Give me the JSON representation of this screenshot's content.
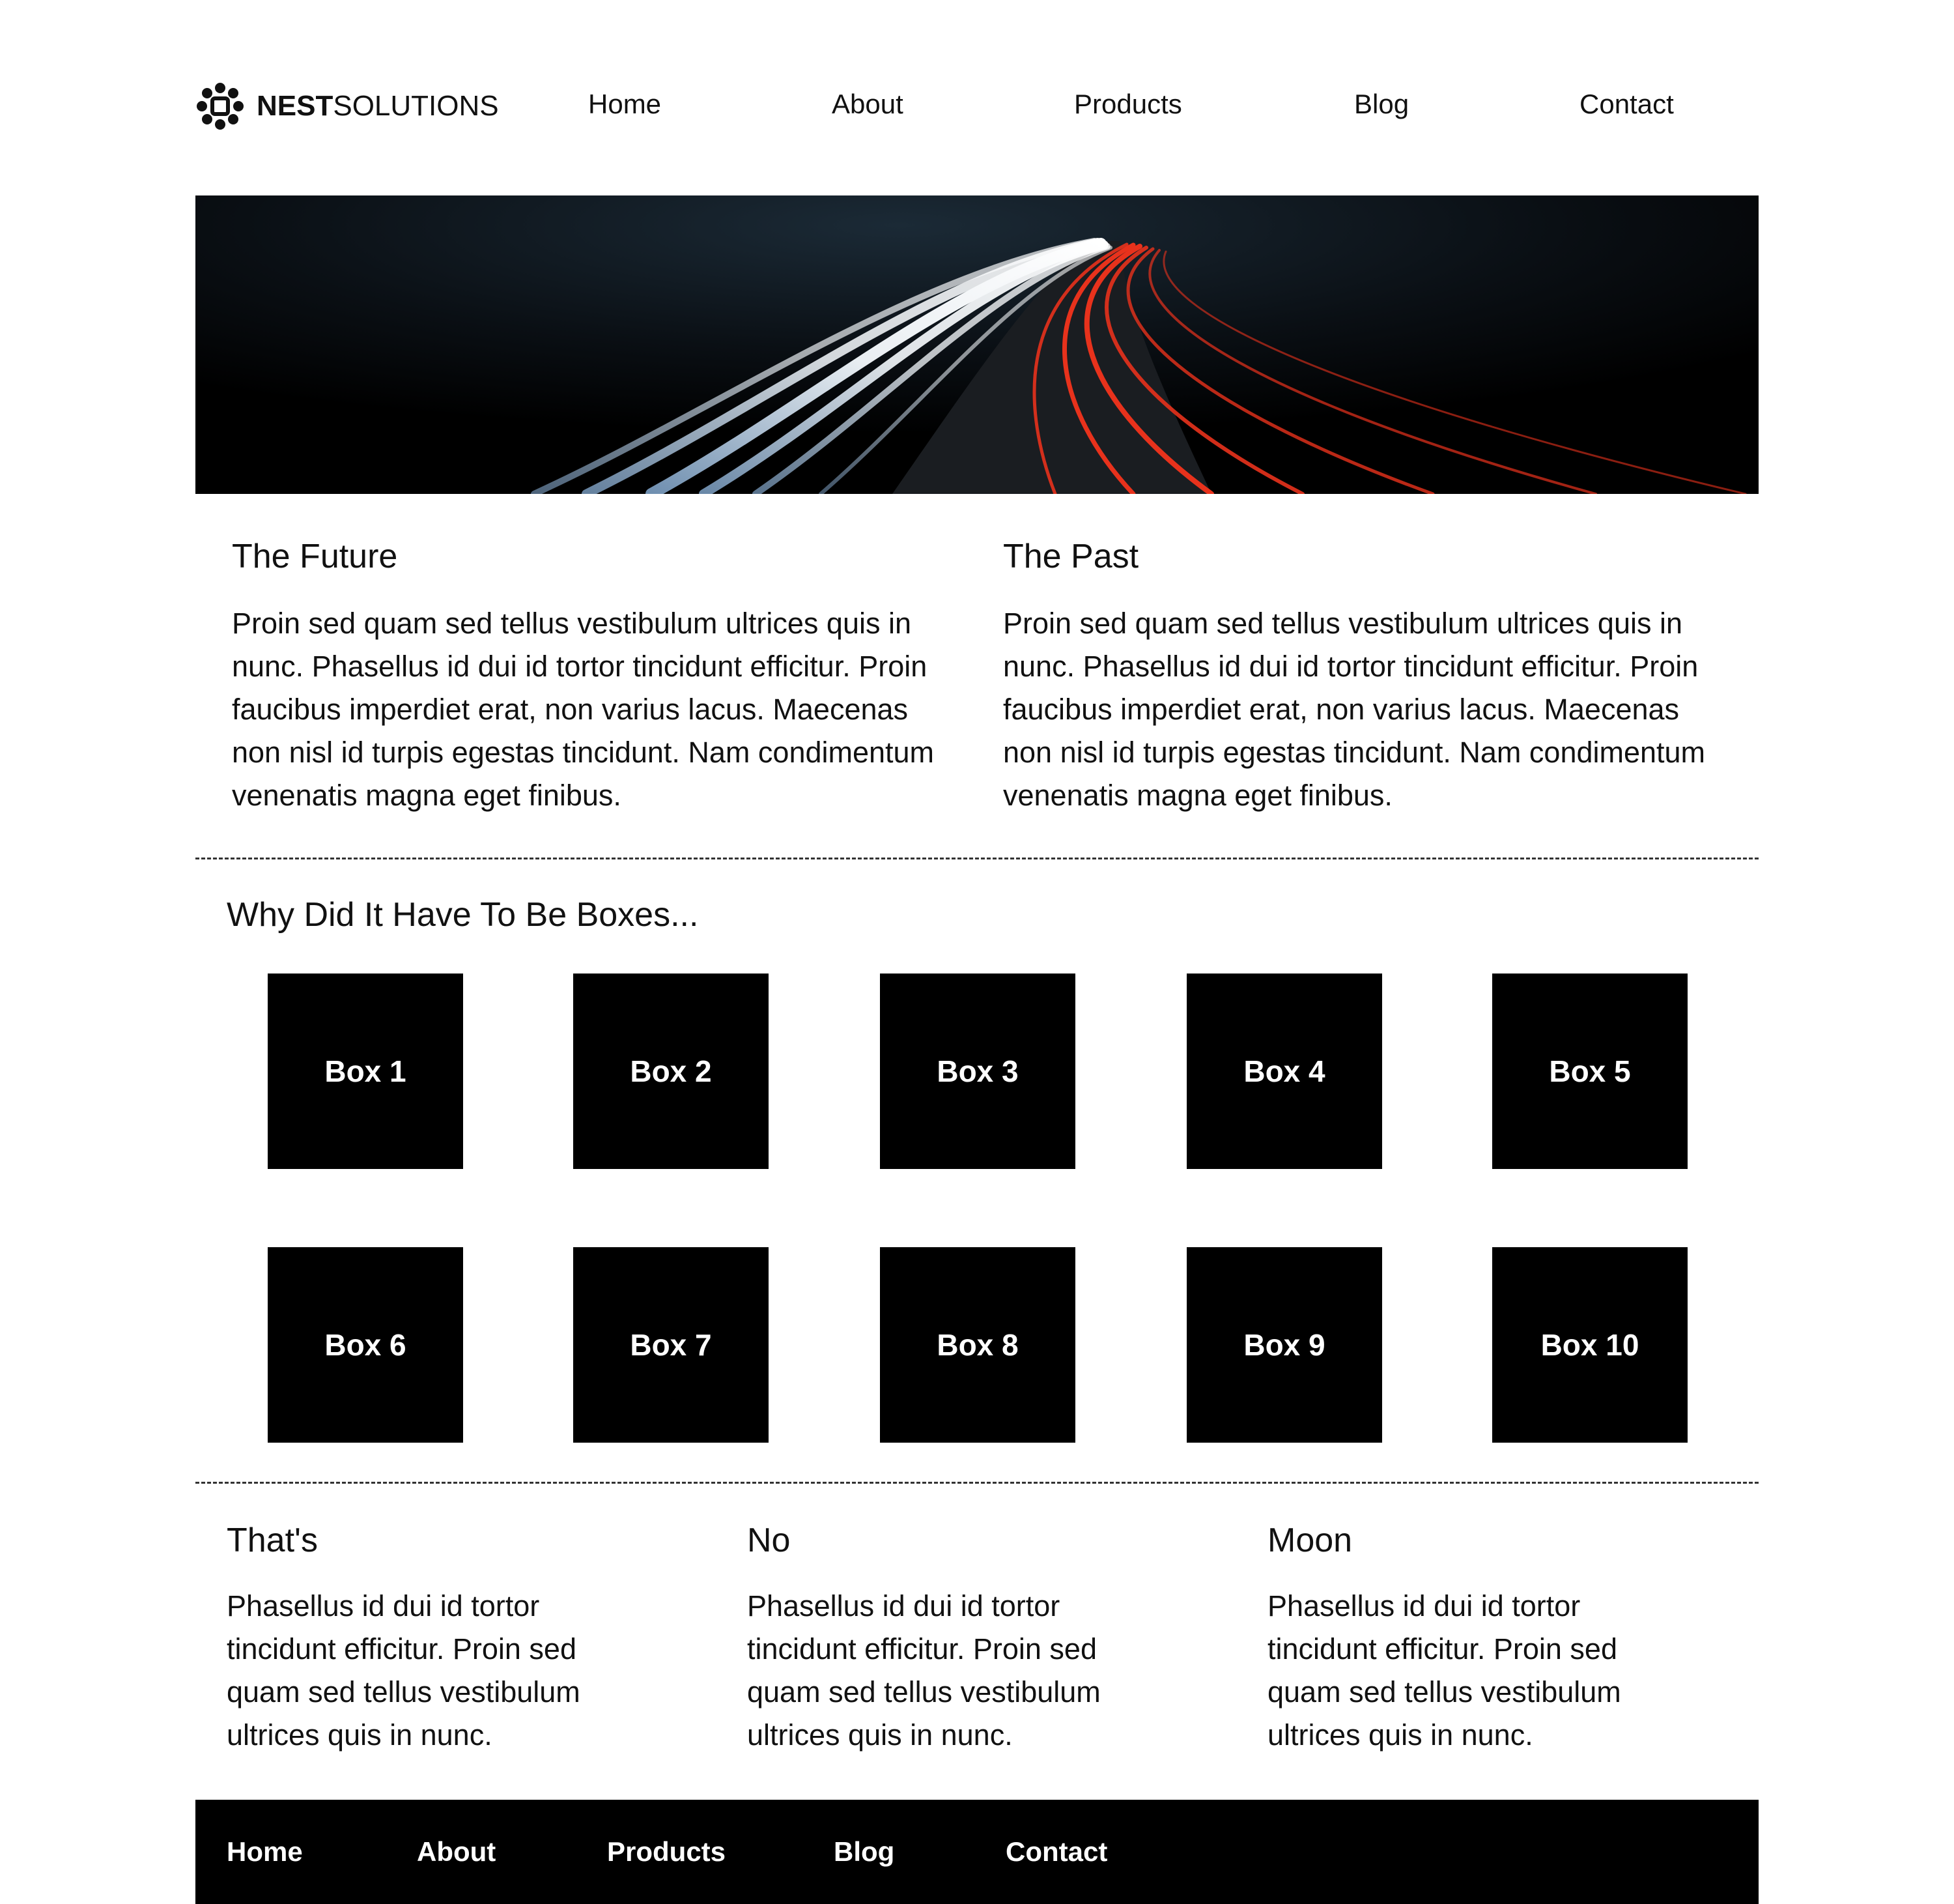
{
  "brand": {
    "bold": "NEST",
    "regular": "SOLUTIONS"
  },
  "nav": [
    "Home",
    "About",
    "Products",
    "Blog",
    "Contact"
  ],
  "intro": [
    {
      "title": "The Future",
      "text": "Proin sed quam sed tellus vestibulum ultrices quis in nunc. Phasellus id dui id tortor tincidunt efficitur. Proin faucibus imperdiet erat, non varius lacus. Maecenas non nisl id turpis egestas tincidunt. Nam condimentum venenatis magna eget finibus."
    },
    {
      "title": "The Past",
      "text": "Proin sed quam sed tellus vestibulum ultrices quis in nunc. Phasellus id dui id tortor tincidunt efficitur. Proin faucibus imperdiet erat, non varius lacus. Maecenas non nisl id turpis egestas tincidunt. Nam condimentum venenatis magna eget finibus."
    }
  ],
  "boxes_title": "Why Did It Have To Be Boxes...",
  "boxes": [
    "Box 1",
    "Box 2",
    "Box 3",
    "Box 4",
    "Box 5",
    "Box 6",
    "Box 7",
    "Box 8",
    "Box 9",
    "Box 10"
  ],
  "features": [
    {
      "title": "That's",
      "text": "Phasellus id dui id tortor tincidunt efficitur. Proin sed quam sed tellus vestibulum ultrices quis in nunc."
    },
    {
      "title": "No",
      "text": "Phasellus id dui id tortor tincidunt efficitur. Proin sed quam sed tellus vestibulum ultrices quis in nunc."
    },
    {
      "title": "Moon",
      "text": "Phasellus id dui id tortor tincidunt efficitur. Proin sed quam sed tellus vestibulum ultrices quis in nunc."
    }
  ],
  "footer_nav": [
    "Home",
    "About",
    "Products",
    "Blog",
    "Contact"
  ],
  "colors": {
    "box": "#000000",
    "footer": "#000000",
    "text": "#111111",
    "light_trail_red": "#e8321c"
  },
  "icons": {
    "logo": "nest-logo-icon"
  }
}
